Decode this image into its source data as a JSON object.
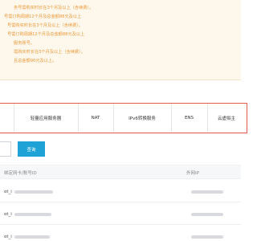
{
  "notice": {
    "lines": [
      "务号需购买时长在3个月及以上（含续费）。",
      "号需订购周期12个月及总金额88元及以上",
      "号需购买时长在3个月及以上（含续费）。",
      "号需订购周期12个月及总金额88元及以上",
      "服务账号。",
      "需购买时长在3个月及以上（含续费）。",
      "且总金额90元及以上。"
    ]
  },
  "product_tabs": [
    "轻量应用服务器",
    "NAT",
    "IPv6转换服务",
    "ENS",
    "云虚拟主"
  ],
  "search": {
    "button_label": "查询"
  },
  "table": {
    "columns": [
      "绑定网卡/账号ID",
      "外网IP"
    ],
    "row_prefixes": [
      "ot_i",
      "ot_i",
      "ot_i"
    ]
  }
}
